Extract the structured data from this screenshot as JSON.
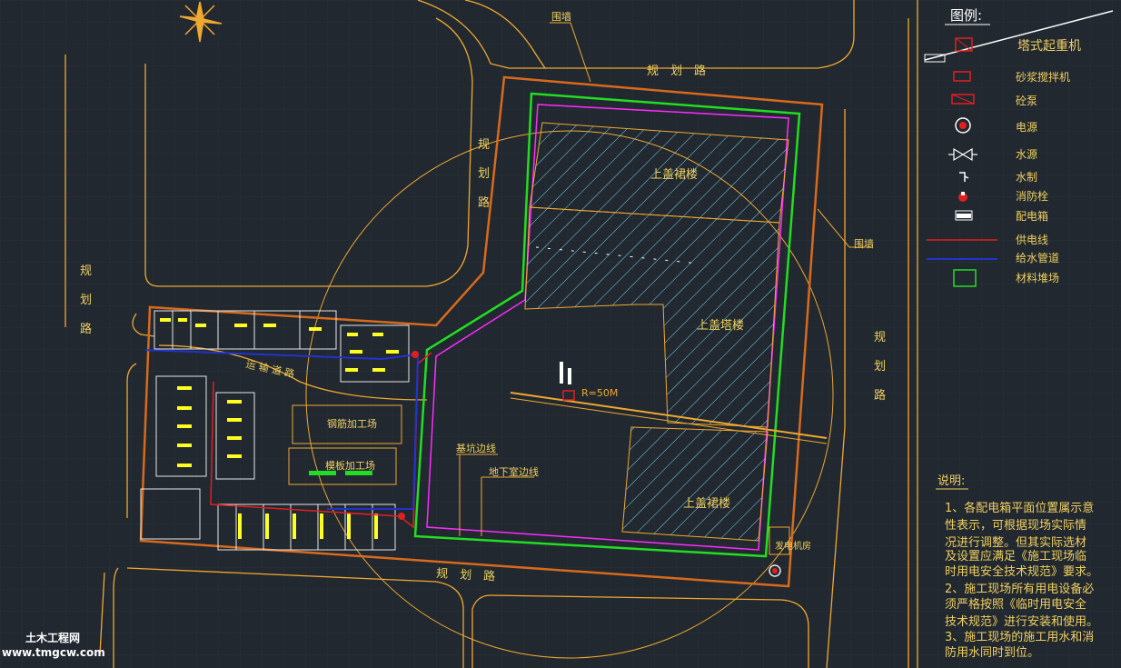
{
  "drawing": {
    "grid_color": "#2d353f",
    "road_color": "#f0a830",
    "boundary_color": "#d86a1c",
    "pit_color": "#ff2bff",
    "material_color": "#22dd22",
    "power_color": "#e02020",
    "water_color": "#2233cc",
    "hatch_color": "#7fd7f0",
    "label_color": "#f0d060",
    "fence_label": "围墙",
    "road_label": "规　划　路",
    "road_label_chars": [
      "规",
      "划",
      "路"
    ],
    "tower_radius_label": "R=50M",
    "transport_road_label": "运 输 道 路",
    "steel_shop_label": "钢筋加工场",
    "formwork_shop_label": "模板加工场",
    "pit_edge_label": "基坑边线",
    "basement_edge_label": "地下室边线",
    "power_room_label": "发电机房",
    "building_labels": [
      "上盖裙楼",
      "上盖塔楼",
      "上盖裙楼"
    ]
  },
  "legend": {
    "title": "图例:",
    "items": [
      {
        "label": "塔式起重机",
        "icon": "tower-crane-icon"
      },
      {
        "label": "砂浆搅拌机",
        "icon": "mortar-mixer-icon"
      },
      {
        "label": "砼泵",
        "icon": "concrete-pump-icon"
      },
      {
        "label": "电源",
        "icon": "power-source-icon"
      },
      {
        "label": "水源",
        "icon": "water-source-icon"
      },
      {
        "label": "水制",
        "icon": "water-valve-icon"
      },
      {
        "label": "消防栓",
        "icon": "fire-hydrant-icon"
      },
      {
        "label": "配电箱",
        "icon": "distribution-box-icon"
      },
      {
        "label": "供电线",
        "icon": "power-line-icon"
      },
      {
        "label": "给水管道",
        "icon": "water-pipe-icon"
      },
      {
        "label": "材料堆场",
        "icon": "material-yard-icon"
      }
    ]
  },
  "notes": {
    "title": "说明:",
    "lines": [
      "1、各配电箱平面位置属示意",
      "性表示，可根据现场实际情",
      "况进行调整。但其实际选材",
      "及设置应满足《施工现场临",
      "时用电安全技术规范》要求。",
      "2、施工现场所有用电设备必",
      "须严格按照《临时用电安全",
      "技术规范》进行安装和使用。",
      "3、施工现场的施工用水和消",
      "防用水同时到位。"
    ]
  },
  "watermark": {
    "line1": "土木工程网",
    "line2": "www.tmgcw.com"
  }
}
